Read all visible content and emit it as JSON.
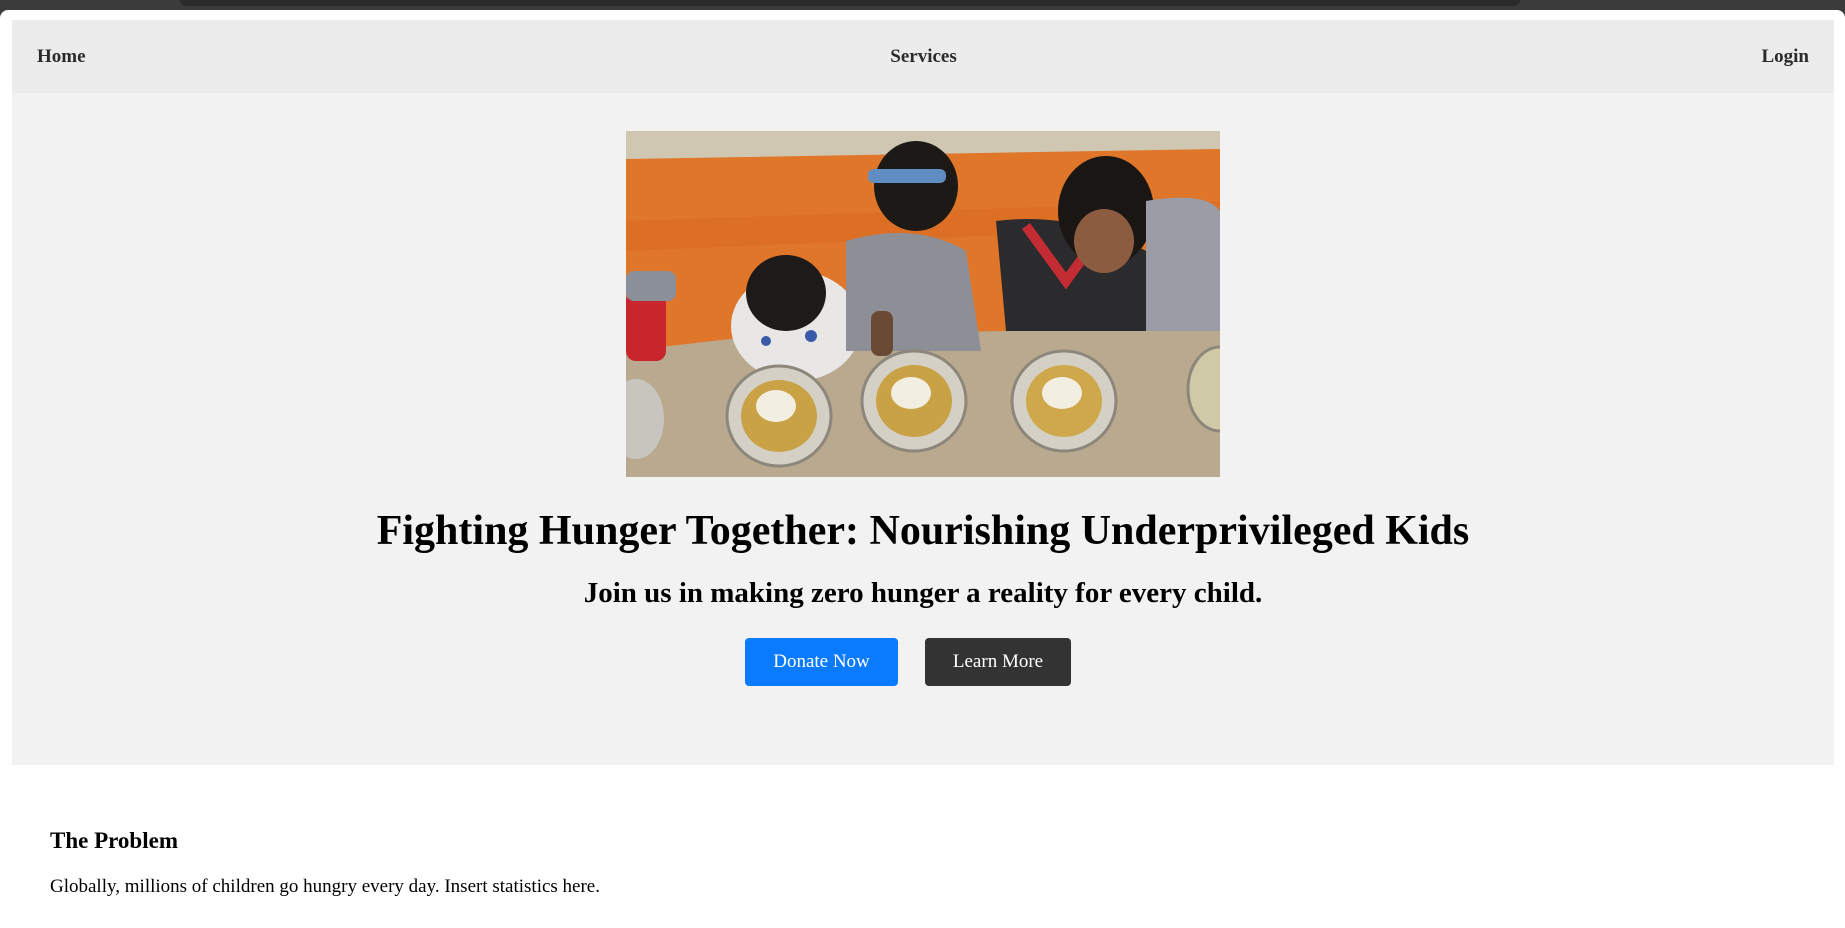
{
  "nav": {
    "home": "Home",
    "services": "Services",
    "login": "Login"
  },
  "hero": {
    "title": "Fighting Hunger Together: Nourishing Underprivileged Kids",
    "subtitle": "Join us in making zero hunger a reality for every child.",
    "donate_label": "Donate Now",
    "learn_label": "Learn More",
    "image_alt": "Children eating meals from steel plates"
  },
  "problem": {
    "heading": "The Problem",
    "text": "Globally, millions of children go hungry every day. Insert statistics here."
  },
  "colors": {
    "primary": "#0a7bff",
    "dark_button": "#333333",
    "nav_bg": "#ececec",
    "hero_bg": "#f2f2f2"
  }
}
